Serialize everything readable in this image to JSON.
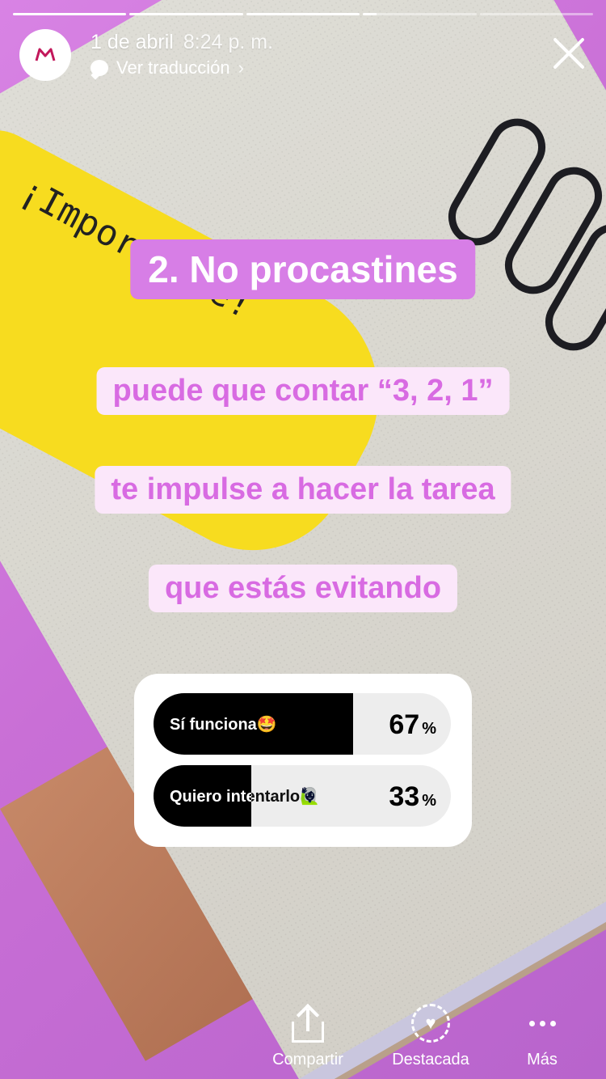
{
  "progress": {
    "segments": [
      1,
      1,
      1,
      0.12,
      0
    ]
  },
  "header": {
    "avatar_logo": "M",
    "date": "1 de abril",
    "time": "8:24 p. m.",
    "translate_label": "Ver traducción"
  },
  "background": {
    "sticky_note_text": "¡Importante!"
  },
  "story": {
    "title": "2. No procastines",
    "lines": [
      "puede que contar “3, 2, 1”",
      "te impulse a hacer la tarea",
      "que estás evitando"
    ]
  },
  "poll": {
    "options": [
      {
        "label": "Sí funciona",
        "emoji": "🤩",
        "percent": 67,
        "percent_sign": "%"
      },
      {
        "label": "Quiero intentarlo",
        "emoji": "🙋🏻‍♀️",
        "percent": 33,
        "percent_sign": "%"
      }
    ]
  },
  "actions": {
    "share": "Compartir",
    "highlight": "Destacada",
    "more": "Más"
  },
  "colors": {
    "title_bg": "#d77ee6",
    "line_bg": "#fbe7fa",
    "line_text": "#d86be2",
    "sticky": "#f7dc1f"
  }
}
